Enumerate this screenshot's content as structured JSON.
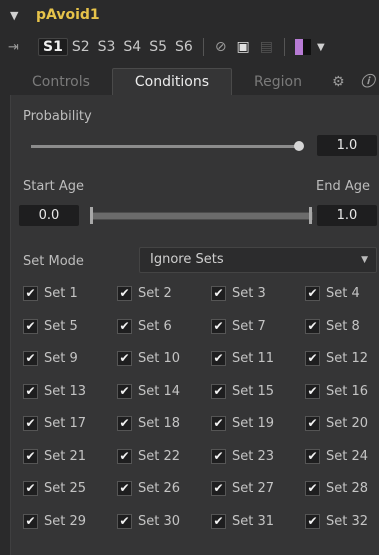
{
  "header": {
    "title": "pAvoid1"
  },
  "slots": [
    "S1",
    "S2",
    "S3",
    "S4",
    "S5",
    "S6"
  ],
  "tabs": [
    "Controls",
    "Conditions",
    "Region"
  ],
  "probability": {
    "label": "Probability",
    "value": "1.0",
    "level": 1.0
  },
  "age": {
    "start_label": "Start Age",
    "end_label": "End Age",
    "start": "0.0",
    "end": "1.0"
  },
  "set_mode": {
    "label": "Set Mode",
    "value": "Ignore Sets"
  },
  "sets": [
    "Set 1",
    "Set 2",
    "Set 3",
    "Set 4",
    "Set 5",
    "Set 6",
    "Set 7",
    "Set 8",
    "Set 9",
    "Set 10",
    "Set 11",
    "Set 12",
    "Set 13",
    "Set 14",
    "Set 15",
    "Set 16",
    "Set 17",
    "Set 18",
    "Set 19",
    "Set 20",
    "Set 21",
    "Set 22",
    "Set 23",
    "Set 24",
    "Set 25",
    "Set 26",
    "Set 27",
    "Set 28",
    "Set 29",
    "Set 30",
    "Set 31",
    "Set 32"
  ],
  "colors": {
    "title": "#e6c34a",
    "swatch_left": "#b77bd4",
    "swatch_right": "#101010"
  },
  "icons": [
    "chevron-down-icon",
    "pin-icon",
    "disable-icon",
    "lock-icon",
    "cache-icon",
    "gear-icon",
    "info-icon",
    "check-icon"
  ]
}
